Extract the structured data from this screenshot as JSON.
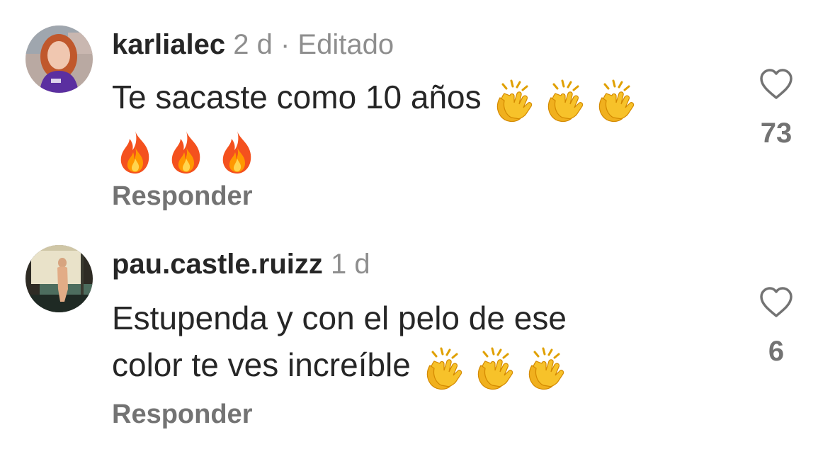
{
  "comments": [
    {
      "username": "karlialec",
      "meta": "2 d · Editado",
      "text_line1": "Te sacaste como 10 años",
      "text_line2": "",
      "emojis_line1": [
        "clapping-hands",
        "clapping-hands",
        "clapping-hands"
      ],
      "emojis_line2": [
        "fire",
        "fire",
        "fire"
      ],
      "reply_label": "Responder",
      "likes": "73"
    },
    {
      "username": "pau.castle.ruizz",
      "meta": "1 d",
      "text_line1": "Estupenda y con el pelo de ese",
      "text_line2": "color te ves increíble",
      "emojis_line2": [
        "clapping-hands",
        "clapping-hands",
        "clapping-hands"
      ],
      "reply_label": "Responder",
      "likes": "6"
    }
  ],
  "colors": {
    "text_primary": "#262626",
    "text_secondary": "#8e8e8e",
    "reply_color": "#737373",
    "background": "#ffffff"
  },
  "icons": {
    "like": "heart-outline-icon",
    "clap": "clapping-hands",
    "fire": "fire"
  }
}
